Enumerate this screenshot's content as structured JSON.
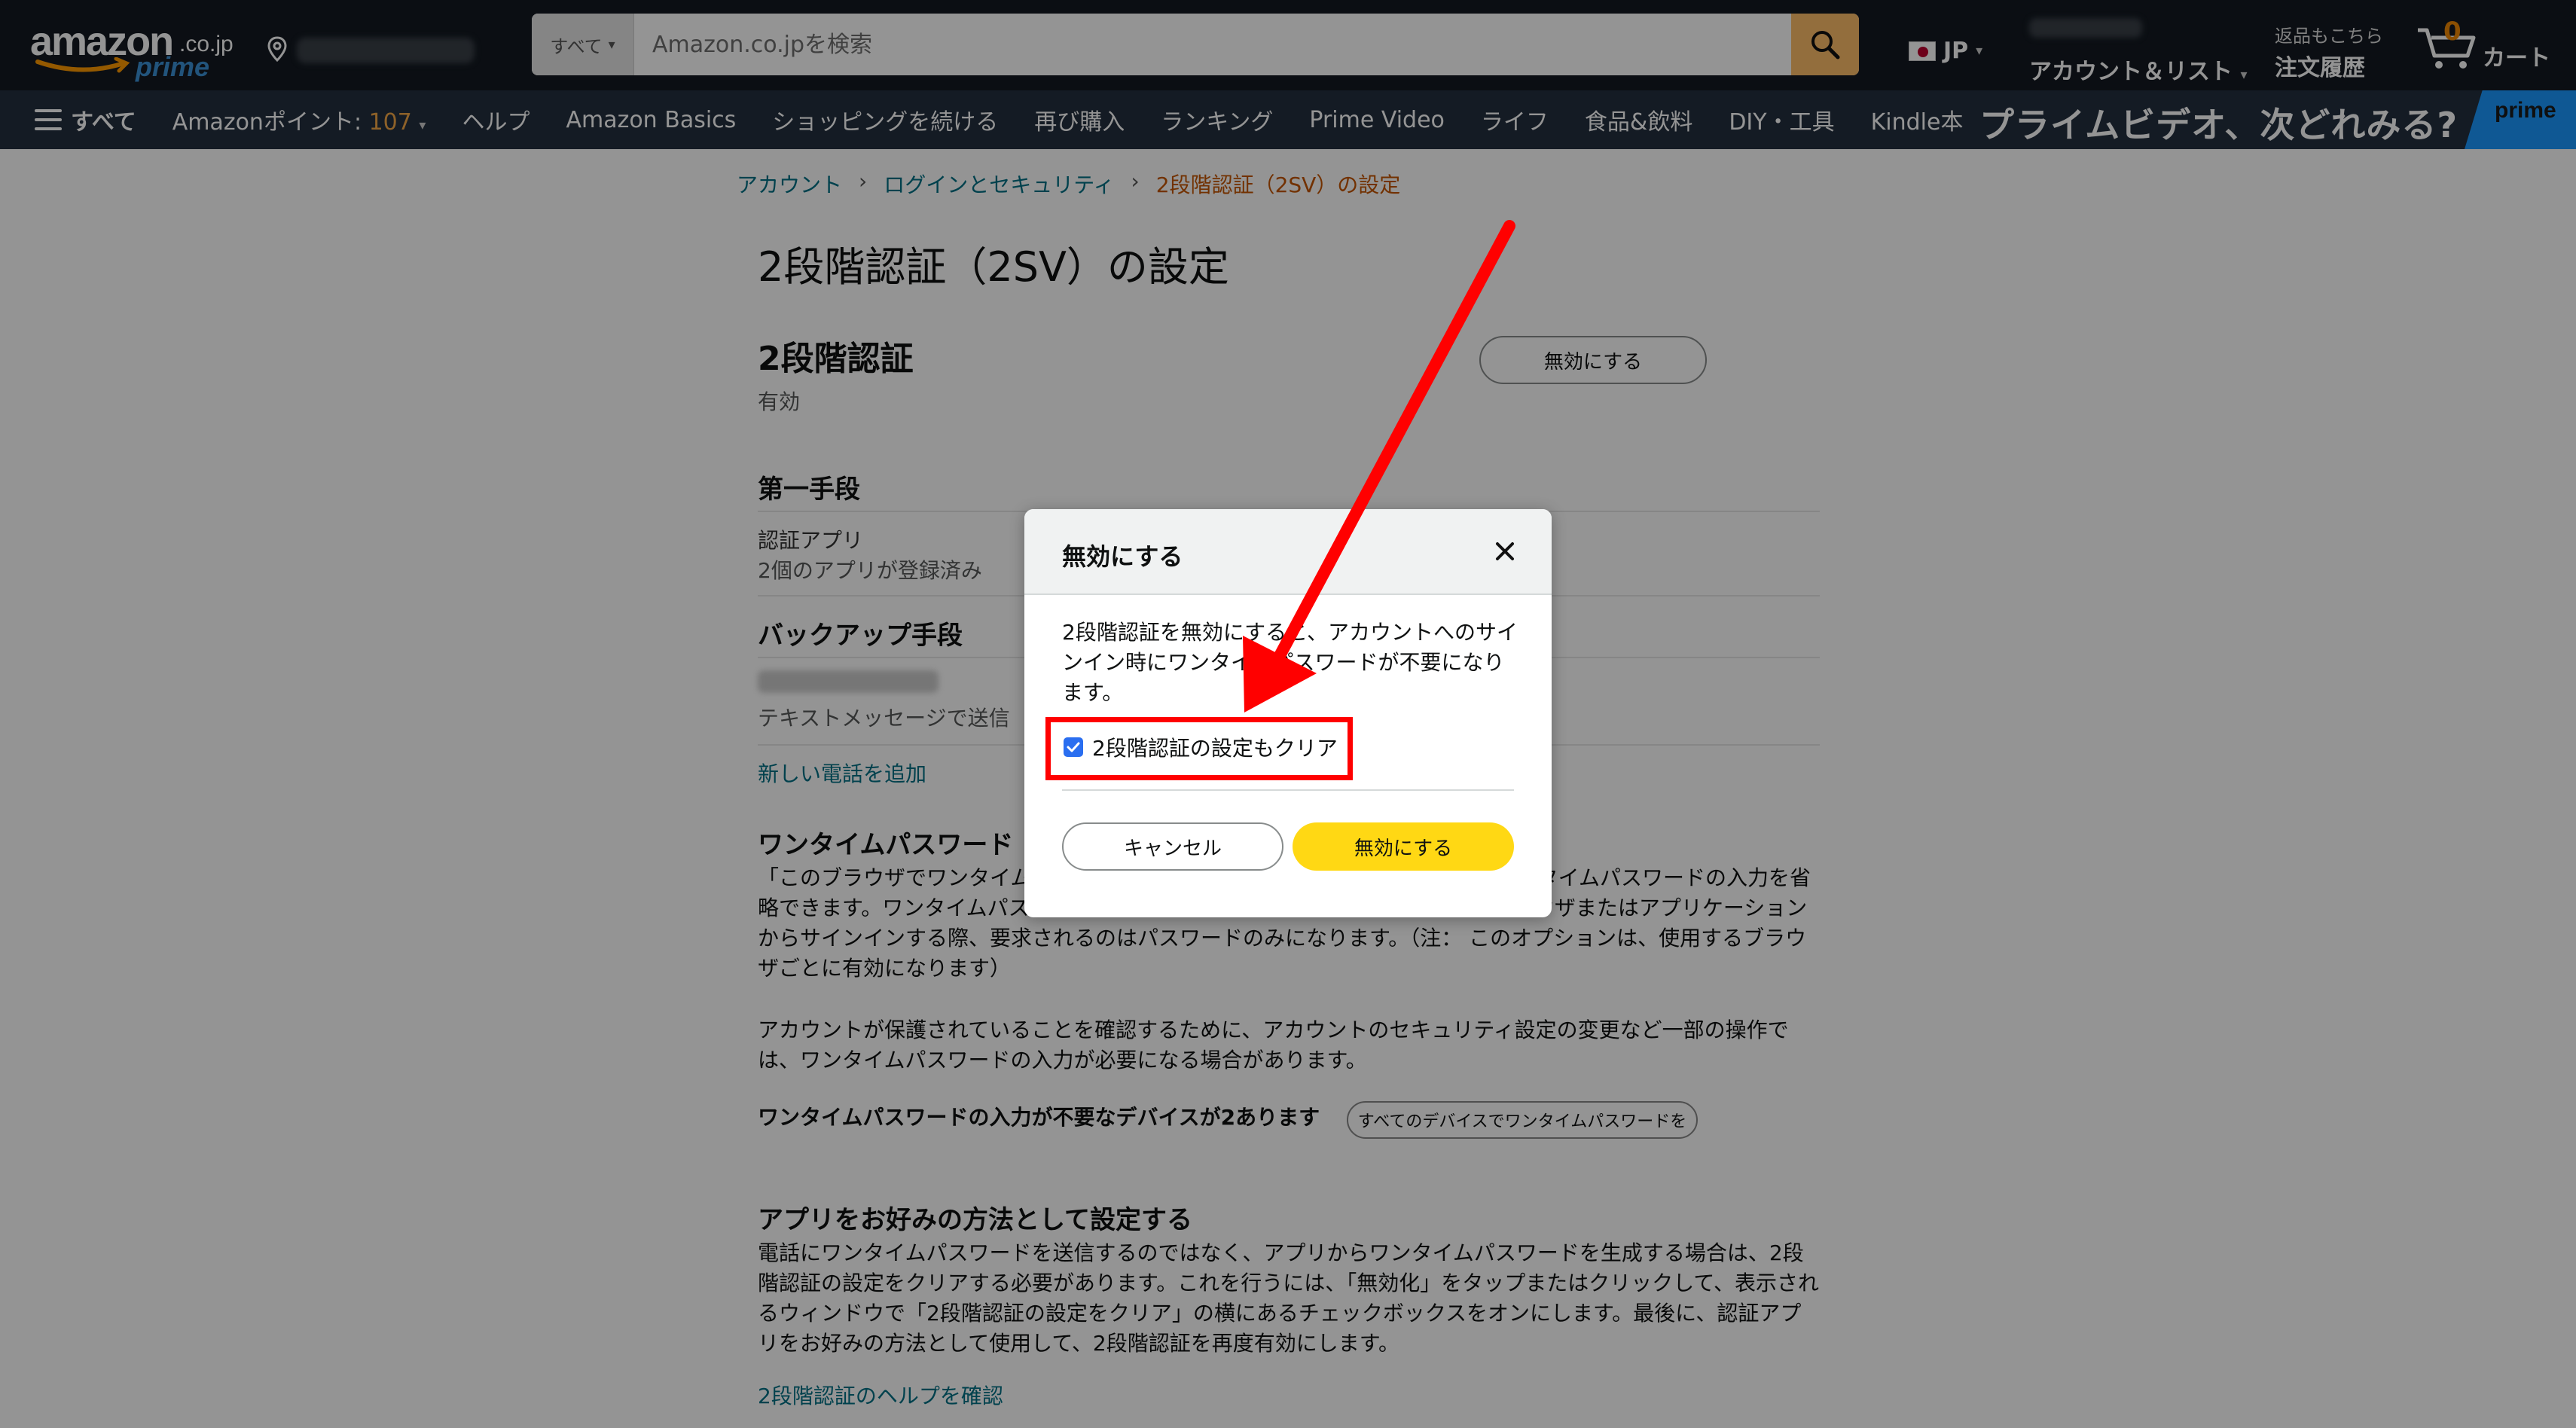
{
  "header": {
    "logo_text": "amazon",
    "logo_tld": ".co.jp",
    "logo_prime": "prime",
    "search_category": "すべて",
    "search_placeholder": "Amazon.co.jpを検索",
    "language": "JP",
    "account_label": "アカウント＆リスト",
    "orders_small": "返品もこちら",
    "orders_label": "注文履歴",
    "cart_count": "0",
    "cart_label": "カート"
  },
  "nav": {
    "all": "すべて",
    "points_label": "Amazonポイント: ",
    "points_value": "107",
    "items": [
      "ヘルプ",
      "Amazon Basics",
      "ショッピングを続ける",
      "再び購入",
      "ランキング",
      "Prime Video",
      "ライフ",
      "食品&飲料",
      "DIY・工具",
      "Kindle本"
    ],
    "banner_text": "プライムビデオ、次どれみる?",
    "banner_prime": "prime"
  },
  "breadcrumb": [
    "アカウント",
    "ログインとセキュリティ",
    "2段階認証（2SV）の設定"
  ],
  "page": {
    "title": "2段階認証（2SV）の設定",
    "section_title": "2段階認証",
    "status": "有効",
    "disable_button": "無効にする",
    "primary_heading": "第一手段",
    "primary_method": "認証アプリ",
    "primary_detail": "2個のアプリが登録済み",
    "backup_heading": "バックアップ手段",
    "backup_detail": "テキストメッセージで送信",
    "add_phone_link": "新しい電話を追加",
    "otp_heading": "ワンタイムパスワード",
    "otp_para1": "「このブラウザでワンタイムパスワードの入力を不要にする」を選択すると、ワンタイムパスワードの入力を省略できます。ワンタイムパスワードの入力を不要にしておくと、次回以降そのブラウザまたはアプリケーションからサインインする際、要求されるのはパスワードのみになります。（注： このオプションは、使用するブラウザごとに有効になります）",
    "otp_para2": "アカウントが保護されていることを確認するために、アカウントのセキュリティ設定の変更など一部の操作では、ワンタイムパスワードの入力が必要になる場合があります。",
    "otp_devices": "ワンタイムパスワードの入力が不要なデバイスが2あります",
    "otp_devices_button": "すべてのデバイスでワンタイムパスワードを",
    "app_heading": "アプリをお好みの方法として設定する",
    "app_para": "電話にワンタイムパスワードを送信するのではなく、アプリからワンタイムパスワードを生成する場合は、2段階認証の設定をクリアする必要があります。これを行うには、「無効化」をタップまたはクリックして、表示されるウィンドウで「2段階認証の設定をクリア」の横にあるチェックボックスをオンにします。最後に、認証アプリをお好みの方法として使用して、2段階認証を再度有効にします。",
    "help_link": "2段階認証のヘルプを確認"
  },
  "modal": {
    "title": "無効にする",
    "body": "2段階認証を無効にすると、アカウントへのサインイン時にワンタイムパスワードが不要になります。",
    "checkbox_label": "2段階認証の設定もクリア",
    "checkbox_checked": true,
    "cancel_button": "キャンセル",
    "confirm_button": "無効にする"
  },
  "colors": {
    "header_bg": "#131921",
    "nav_bg": "#232f3e",
    "link": "#007185",
    "breadcrumb_current": "#c45500",
    "confirm_button": "#ffd814",
    "annotation_red": "#ff0000"
  }
}
